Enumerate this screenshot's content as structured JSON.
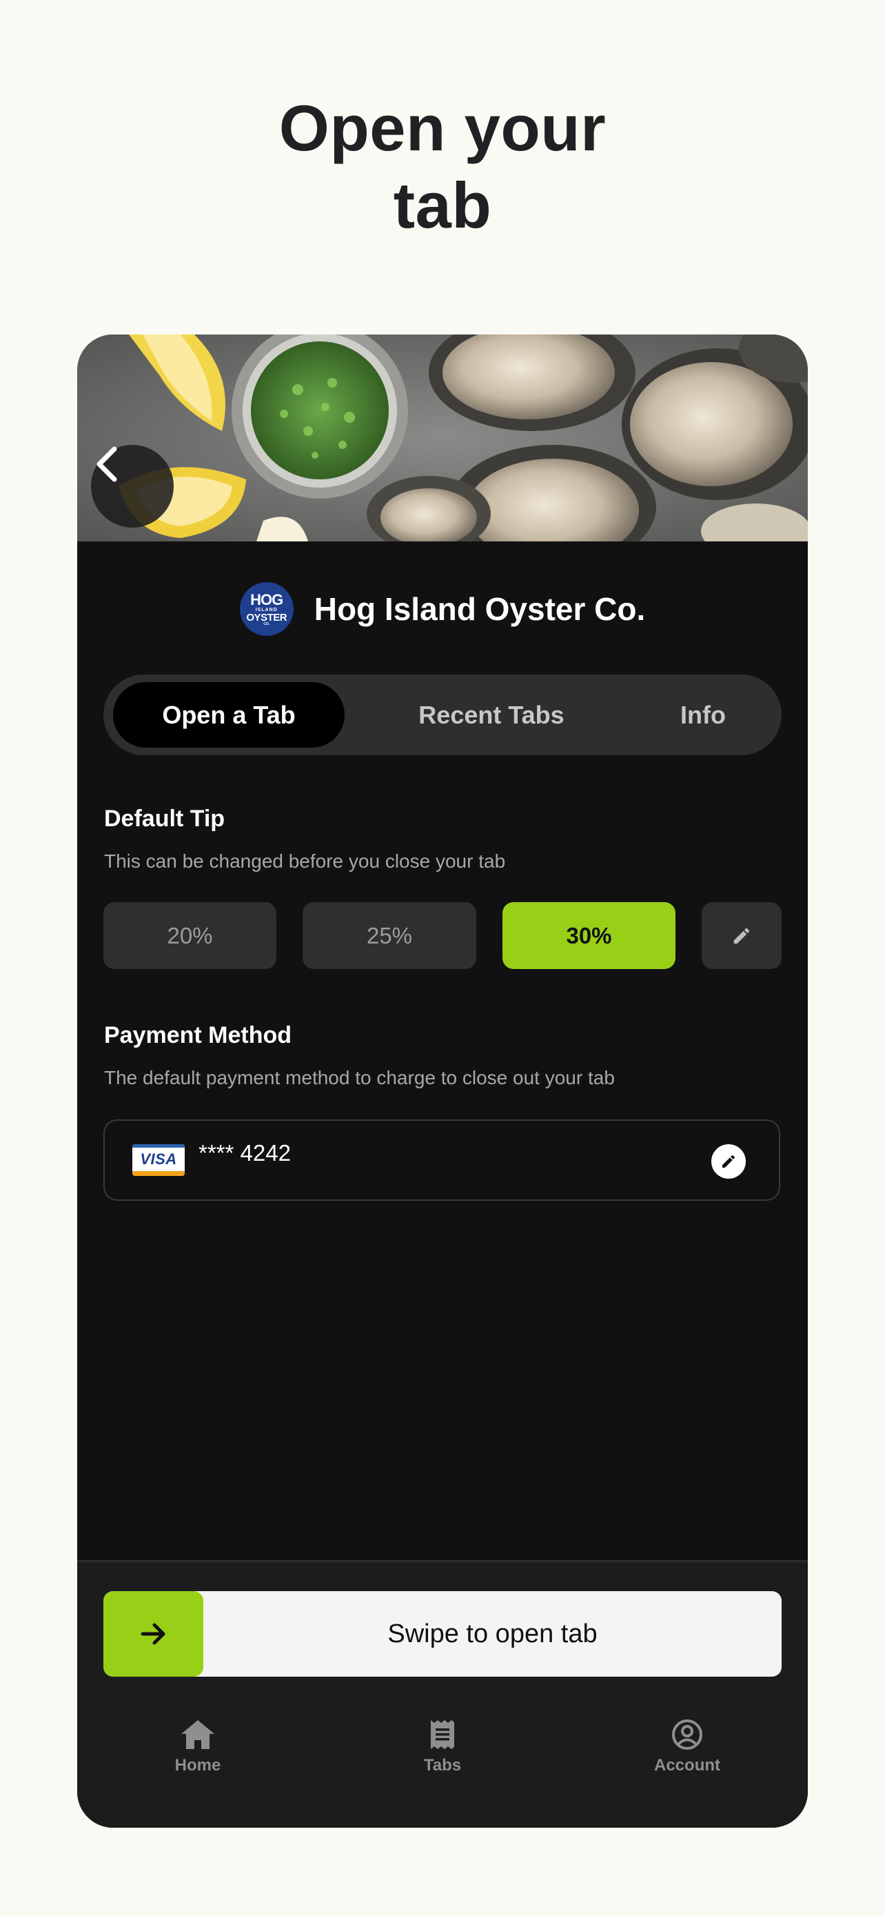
{
  "page": {
    "headline_line1": "Open your",
    "headline_line2": "tab"
  },
  "venue": {
    "name": "Hog Island Oyster Co.",
    "logo_text": [
      "HOG",
      "ISLAND",
      "OYSTER",
      "CO."
    ]
  },
  "tabs": [
    {
      "label": "Open a Tab",
      "active": true
    },
    {
      "label": "Recent Tabs",
      "active": false
    },
    {
      "label": "Info",
      "active": false
    }
  ],
  "tip": {
    "title": "Default Tip",
    "subtitle": "This can be changed before you close your tab",
    "options": [
      {
        "label": "20%",
        "selected": false
      },
      {
        "label": "25%",
        "selected": false
      },
      {
        "label": "30%",
        "selected": true
      }
    ],
    "edit_icon": "pencil-icon"
  },
  "payment": {
    "title": "Payment Method",
    "subtitle": "The default payment method to charge to close out your tab",
    "card_brand": "VISA",
    "card_number": "**** 4242",
    "edit_icon": "pencil-icon"
  },
  "swipe": {
    "label": "Swipe to open tab",
    "icon": "arrow-right-icon"
  },
  "bottom_nav": [
    {
      "label": "Home",
      "icon": "home-icon"
    },
    {
      "label": "Tabs",
      "icon": "receipt-icon"
    },
    {
      "label": "Account",
      "icon": "account-icon"
    }
  ],
  "colors": {
    "background": "#f9faf3",
    "accent": "#98d018",
    "panel": "#111111",
    "segment_bg": "#2e2e2e"
  }
}
